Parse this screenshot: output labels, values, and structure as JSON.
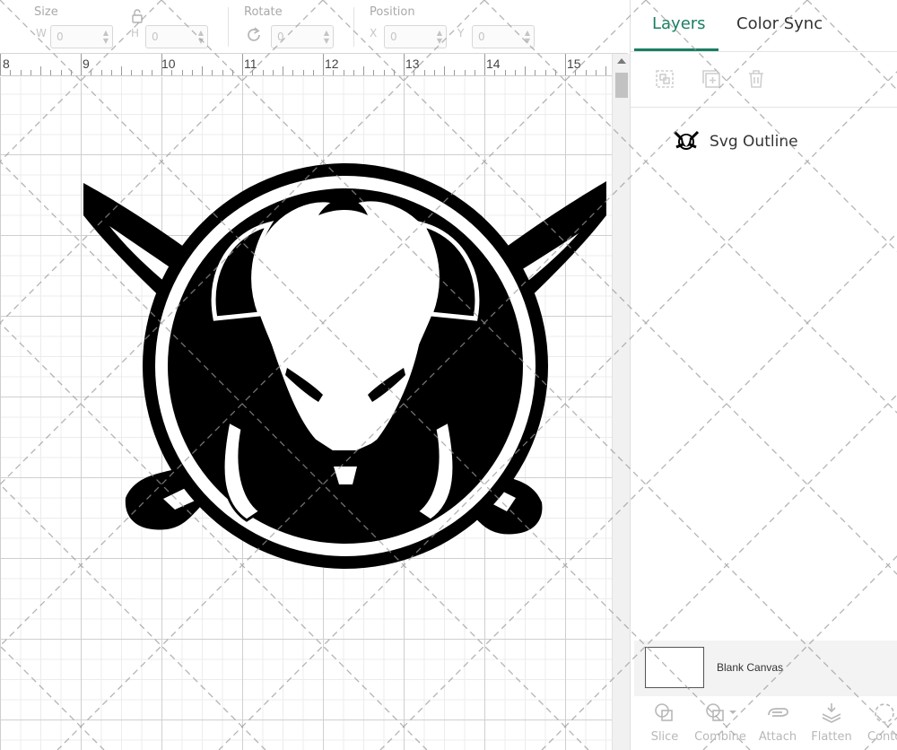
{
  "toolbar": {
    "size_label": "Size",
    "w_label": "W",
    "w_value": "0",
    "h_label": "H",
    "h_value": "0",
    "rotate_label": "Rotate",
    "rotate_value": "0",
    "position_label": "Position",
    "x_label": "X",
    "x_value": "0",
    "y_label": "Y",
    "y_value": "0"
  },
  "ruler": {
    "numbers": [
      "8",
      "9",
      "10",
      "11",
      "12",
      "13",
      "14",
      "15"
    ]
  },
  "panel": {
    "tabs": [
      {
        "label": "Layers",
        "active": true
      },
      {
        "label": "Color Sync",
        "active": false
      }
    ],
    "layers": [
      {
        "name": "Svg Outline",
        "icon": "buffalo-logo-thumbnail"
      }
    ],
    "canvas_label": "Blank Canvas",
    "actions": [
      {
        "label": "Slice",
        "icon": "slice-icon"
      },
      {
        "label": "Combine",
        "icon": "combine-icon"
      },
      {
        "label": "Attach",
        "icon": "attach-icon"
      },
      {
        "label": "Flatten",
        "icon": "flatten-icon"
      },
      {
        "label": "Conto",
        "icon": "contour-icon"
      }
    ]
  },
  "colors": {
    "accent": "#1a7f62",
    "disabled": "#b8b8b8",
    "grid": "#cfcfcf"
  }
}
